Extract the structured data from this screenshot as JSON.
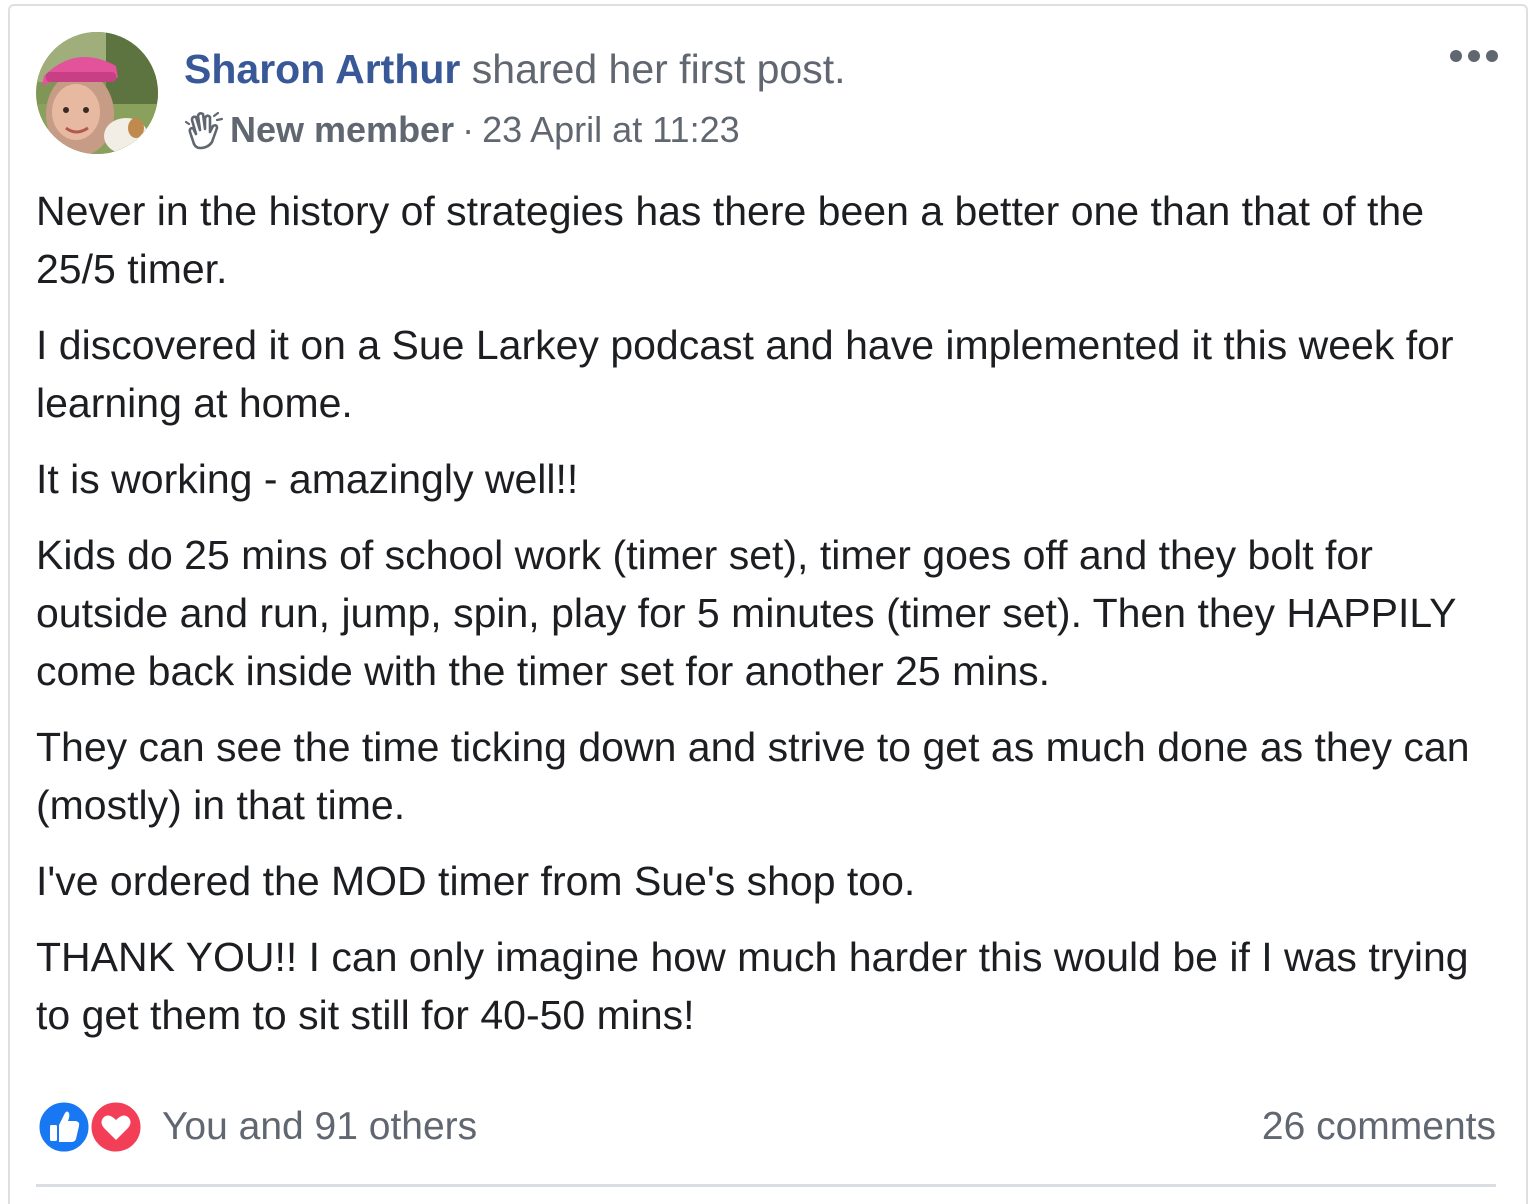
{
  "post": {
    "author_name": "Sharon Arthur",
    "action_text": "shared her first post.",
    "badge_label": "New member",
    "separator": "·",
    "timestamp": "23 April at 11:23",
    "avatar_icon": "profile-photo",
    "badge_icon": "waving-hand-icon",
    "menu_icon": "more-options-icon",
    "paragraphs": [
      "Never in the history of strategies has there been a better one than that of the 25/5 timer.",
      "I discovered it on a Sue Larkey podcast and have implemented it this week for learning at home.",
      "It is working - amazingly well!!",
      "Kids do 25 mins of school work (timer set), timer goes off and they bolt for outside and run, jump, spin, play for 5 minutes (timer set). Then they HAPPILY come back inside with the timer set for another 25 mins.",
      "They can see the time ticking down and strive to get as much done as they can (mostly) in that time.",
      "I've ordered the MOD timer from Sue's shop too.",
      "THANK YOU!! I can only imagine how much harder this would be if I was trying to get them to sit still for 40-50 mins!"
    ]
  },
  "footer": {
    "reactions_text": "You and 91 others",
    "comments_text": "26 comments",
    "reaction_icons": [
      "like-icon",
      "love-icon"
    ]
  },
  "colors": {
    "author": "#385898",
    "secondary_text": "#606770",
    "body_text": "#1c1e21",
    "like_blue": "#1877f2",
    "love_red": "#f33e58",
    "border": "#dddfe2"
  }
}
